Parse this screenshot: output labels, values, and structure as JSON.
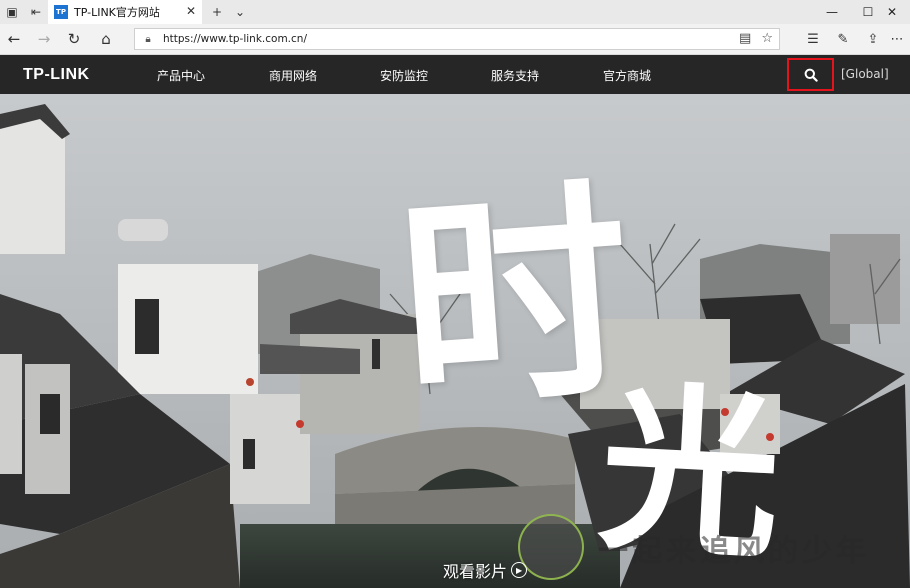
{
  "browser": {
    "tab_title": "TP-LINK官方网站",
    "url": "https://www.tp-link.com.cn/",
    "tab_favicon_text": "TP"
  },
  "site": {
    "logo": "TP-LINK",
    "menu": [
      "产品中心",
      "商用网络",
      "安防监控",
      "服务支持",
      "官方商城"
    ],
    "global_label": "[Global]"
  },
  "hero": {
    "calligraphy_top": "时",
    "calligraphy_bottom": "光",
    "watch_label": "观看影片",
    "watermark_text": "一起来追风的少年"
  },
  "colors": {
    "header_bg": "#262626",
    "highlight_border": "#e5141c",
    "favicon_bg": "#1d73d2"
  }
}
